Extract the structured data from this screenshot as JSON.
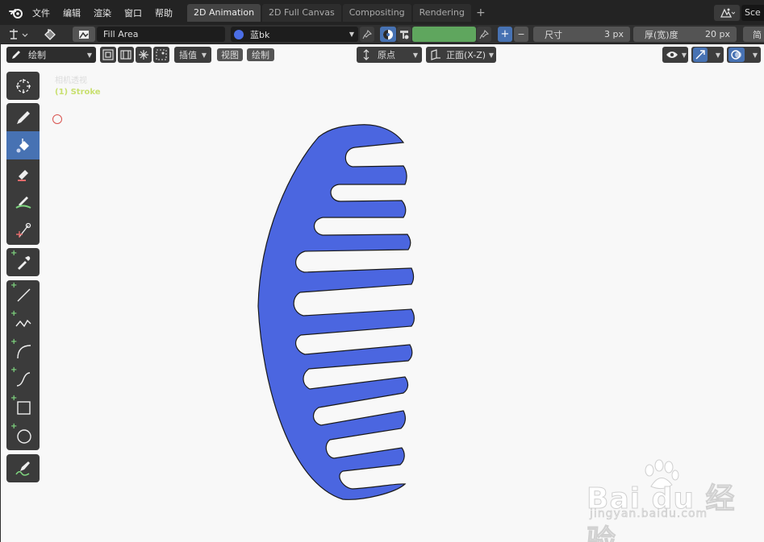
{
  "menu": {
    "items": [
      "文件",
      "编辑",
      "渲染",
      "窗口",
      "帮助"
    ]
  },
  "workspaces": {
    "tabs": [
      "2D Animation",
      "2D Full Canvas",
      "Compositing",
      "Rendering"
    ],
    "active_index": 0,
    "add_label": "+"
  },
  "scene": {
    "name": "Sce"
  },
  "tool_settings": {
    "brush_name": "Fill Area",
    "material_name": "蓝bk",
    "material_color": "#4b6ee6",
    "vertex_color": "#5fa65e",
    "plus_label": "+",
    "minus_label": "−",
    "size_label": "尺寸",
    "size_value": "3 px",
    "thickness_label": "厚(宽)度",
    "thickness_value": "20 px",
    "overflow_label": "简"
  },
  "viewport_header": {
    "mode": "绘制",
    "interpolate": "插值",
    "view_menu": "视图",
    "draw_menu": "绘制",
    "pivot": "原点",
    "orientation": "正面(X-Z)"
  },
  "viewport": {
    "camera_label": "相机透视",
    "object_label": "(1) Stroke",
    "fill_color": "#4b66e0"
  },
  "watermark": {
    "main": "Bai du 经验",
    "sub": "jingyan.baidu.com"
  }
}
